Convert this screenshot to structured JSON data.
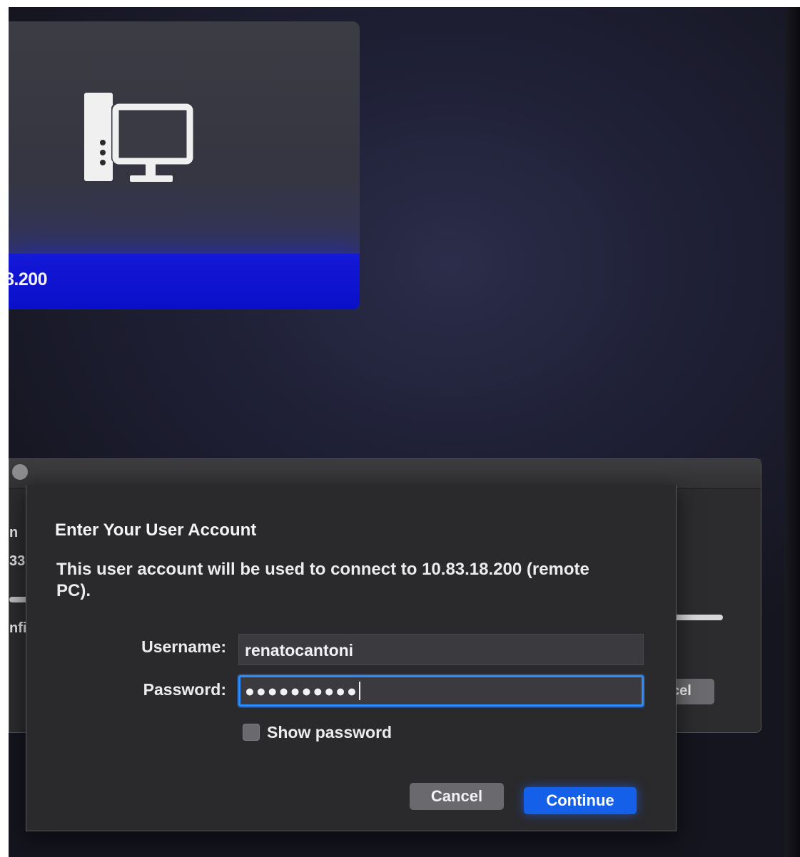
{
  "remote_pc_tile": {
    "address_label": "8.200",
    "icon": "desktop-computer-icon"
  },
  "background_window": {
    "partial_text_1": "n",
    "partial_text_2": "33",
    "partial_text_3": "nfi",
    "partial_button": "cel"
  },
  "dialog": {
    "title": "Enter Your User Account",
    "message": "This user account will be used to connect to 10.83.18.200 (remote PC).",
    "username_label": "Username:",
    "username_value": "renatocantoni",
    "password_label": "Password:",
    "password_value": "●●●●●●●●●●",
    "show_password_label": "Show password",
    "show_password_checked": false,
    "cancel_label": "Cancel",
    "continue_label": "Continue"
  },
  "colors": {
    "accent": "#1460e8",
    "tile_highlight": "#0a10c8",
    "dialog_bg": "#2a2a2d"
  }
}
